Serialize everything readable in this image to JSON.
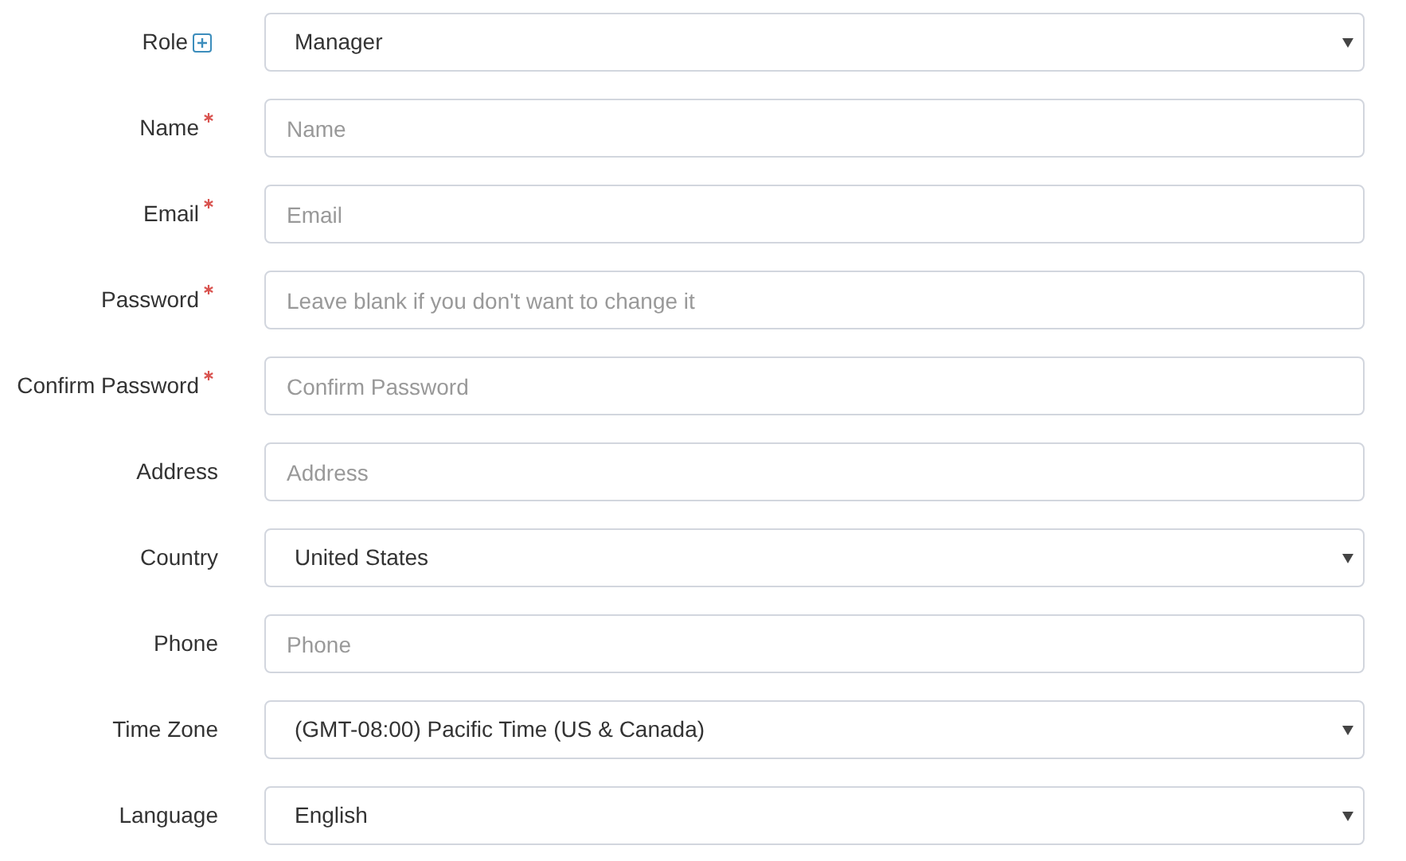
{
  "fields": [
    {
      "label": "Role",
      "required": false,
      "add_button": true,
      "kind": "select",
      "value": "Manager"
    },
    {
      "label": "Name",
      "required": true,
      "kind": "input",
      "placeholder": "Name"
    },
    {
      "label": "Email",
      "required": true,
      "kind": "input",
      "placeholder": "Email"
    },
    {
      "label": "Password",
      "required": true,
      "kind": "input",
      "placeholder": "Leave blank if you don't want to change it"
    },
    {
      "label": "Confirm Password",
      "required": true,
      "kind": "input",
      "placeholder": "Confirm Password"
    },
    {
      "label": "Address",
      "required": false,
      "kind": "input",
      "placeholder": "Address"
    },
    {
      "label": "Country",
      "required": false,
      "kind": "select",
      "value": "United States"
    },
    {
      "label": "Phone",
      "required": false,
      "kind": "input",
      "placeholder": "Phone"
    },
    {
      "label": "Time Zone",
      "required": false,
      "kind": "select",
      "value": "(GMT-08:00) Pacific Time (US & Canada)"
    },
    {
      "label": "Language",
      "required": false,
      "kind": "select",
      "value": "English"
    }
  ]
}
